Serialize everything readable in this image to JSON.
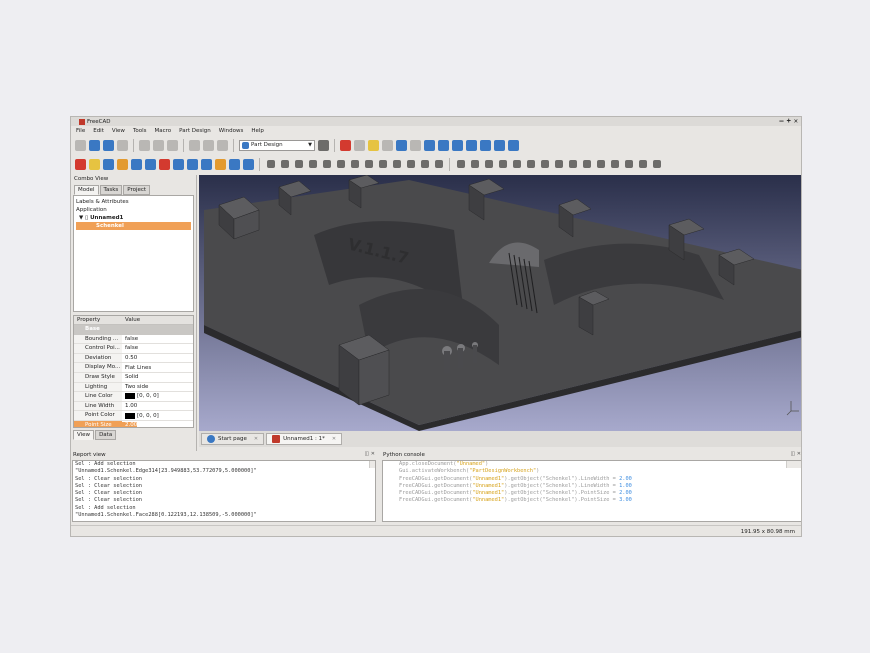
{
  "window": {
    "title": "FreeCAD",
    "controls": [
      "–",
      "+",
      "✕"
    ]
  },
  "menu": [
    "File",
    "Edit",
    "View",
    "Tools",
    "Macro",
    "Part Design",
    "Windows",
    "Help"
  ],
  "workbench": {
    "selected": "Part Design"
  },
  "combo_view": {
    "title": "Combo View",
    "tabs": [
      "Model",
      "Tasks",
      "Project"
    ],
    "tree_header": "Labels & Attributes",
    "tree_root": "Application",
    "document": "Unnamed1",
    "selected_object": "Schenkel",
    "bottom_tabs": [
      "View",
      "Data"
    ]
  },
  "properties": {
    "headers": [
      "Property",
      "Value"
    ],
    "group": "Base",
    "rows": [
      {
        "name": "Bounding ...",
        "value": "false"
      },
      {
        "name": "Control Poi...",
        "value": "false"
      },
      {
        "name": "Deviation",
        "value": "0.50"
      },
      {
        "name": "Display Mo...",
        "value": "Flat Lines"
      },
      {
        "name": "Draw Style",
        "value": "Solid"
      },
      {
        "name": "Lighting",
        "value": "Two side"
      },
      {
        "name": "Line Color",
        "value": "[0, 0, 0]",
        "swatch": "#000000"
      },
      {
        "name": "Line Width",
        "value": "1.00"
      },
      {
        "name": "Point Color",
        "value": "[0, 0, 0]",
        "swatch": "#000000"
      },
      {
        "name": "Point Size",
        "value": "2.00"
      }
    ]
  },
  "viewport": {
    "model_label": "V.1.1.7",
    "background_top": "#2a2f4a",
    "background_bottom": "#a7a9cc"
  },
  "document_tabs": [
    {
      "label": "Start page",
      "active": false
    },
    {
      "label": "Unnamed1 : 1*",
      "active": true
    }
  ],
  "report_view": {
    "title": "Report view",
    "lines": [
      "Sel : Add selection",
      "\"Unnamed1.Schenkel.Edge314[23.949883,53.772079,5.000000]\"",
      "Sel : Clear selection",
      "Sel : Clear selection",
      "Sel : Clear selection",
      "Sel : Clear selection",
      "Sel : Add selection",
      "\"Unnamed1.Schenkel.Face288[0.122193,12.138509,-5.000000]\""
    ]
  },
  "python_console": {
    "title": "Python console",
    "lines": [
      {
        "code": "App.closeDocument(",
        "str": "\"Unnamed\"",
        "tail": ")",
        "num": ""
      },
      {
        "code": "Gui.activateWorkbench(",
        "str": "\"PartDesignWorkbench\"",
        "tail": ")",
        "num": ""
      },
      {
        "code": "FreeCADGui.getDocument(",
        "str": "\"Unnamed1\"",
        "tail": ").getObject(\"Schenkel\").LineWidth = ",
        "num": "2.00"
      },
      {
        "code": "FreeCADGui.getDocument(",
        "str": "\"Unnamed1\"",
        "tail": ").getObject(\"Schenkel\").LineWidth = ",
        "num": "1.00"
      },
      {
        "code": "FreeCADGui.getDocument(",
        "str": "\"Unnamed1\"",
        "tail": ").getObject(\"Schenkel\").PointSize = ",
        "num": "2.00"
      },
      {
        "code": "FreeCADGui.getDocument(",
        "str": "\"Unnamed1\"",
        "tail": ").getObject(\"Schenkel\").PointSize = ",
        "num": "3.00"
      }
    ]
  },
  "status_bar": {
    "dimensions": "191.95 x 80.98 mm"
  },
  "toolbar1_icons": [
    "new-file-icon",
    "open-file-icon",
    "save-icon",
    "print-icon",
    "cut-icon",
    "copy-icon",
    "paste-icon",
    "undo-icon",
    "redo-icon",
    "refresh-icon",
    "record-macro-icon",
    "stop-macro-icon",
    "edit-macro-icon",
    "run-macro-icon",
    "fit-all-icon",
    "axonometric-icon",
    "front-view-icon",
    "top-view-icon",
    "right-view-icon",
    "rear-view-icon",
    "bottom-view-icon",
    "left-view-icon",
    "measure-icon"
  ],
  "toolbar2_icons": [
    "sketch-icon",
    "pad-icon",
    "pocket-icon",
    "revolve-icon",
    "groove-icon",
    "fillet-icon",
    "chamfer-icon",
    "draft-icon",
    "mirror-icon",
    "linear-pattern-icon",
    "polar-pattern-icon",
    "scale-icon",
    "multi-transform-icon",
    "point-icon",
    "line-icon",
    "arc-icon",
    "circle-icon",
    "ellipse-icon",
    "polyline-icon",
    "rectangle-icon",
    "polygon-icon",
    "slot-icon",
    "fillet-sketch-icon",
    "trim-icon",
    "external-icon",
    "construction-icon",
    "coincident-icon",
    "point-on-object-icon",
    "vertical-icon",
    "horizontal-icon",
    "parallel-icon",
    "perpendicular-icon",
    "tangent-icon",
    "equal-icon",
    "symmetric-icon",
    "lock-icon",
    "horizontal-distance-icon",
    "vertical-distance-icon",
    "length-icon",
    "radius-icon",
    "angle-icon"
  ]
}
